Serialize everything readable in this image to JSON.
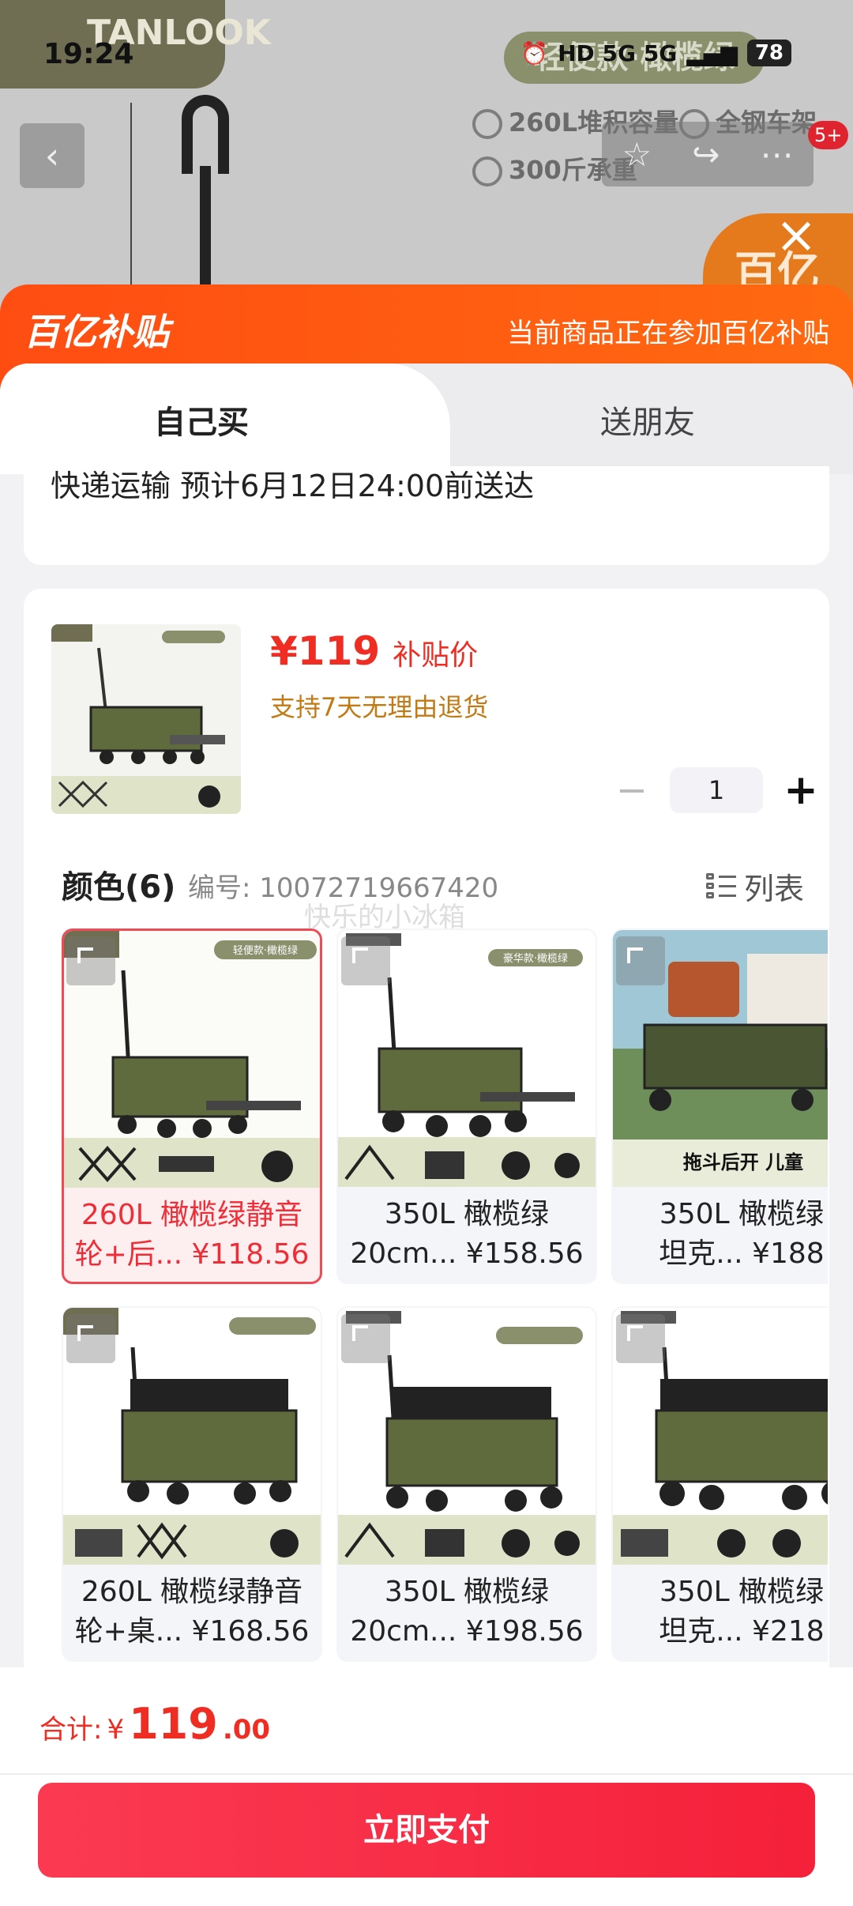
{
  "status_bar": {
    "time": "19:24",
    "network": "HD 5G 5G",
    "battery": "78"
  },
  "background": {
    "brand_logo": "TANLOOK",
    "badge": "轻便款·橄榄绿",
    "features": [
      "260L堆积容量",
      "全钢车架",
      "300斤承重"
    ],
    "corner_logo": "百亿",
    "notification_count": "5+"
  },
  "subsidy_banner": {
    "logo": "百亿补贴",
    "text": "当前商品正在参加百亿补贴"
  },
  "tabs": [
    {
      "label": "自己买"
    },
    {
      "label": "送朋友"
    }
  ],
  "delivery": {
    "text": "快递运输 预计6月12日24:00前送达"
  },
  "product": {
    "price": "¥119",
    "price_label": "补贴价",
    "return_policy": "支持7天无理由退货",
    "quantity": "1"
  },
  "options": {
    "title": "颜色(6)",
    "sku": "编号: 10072719667420",
    "view_mode": "列表",
    "watermark": "快乐的小冰箱",
    "items": [
      {
        "line1": "260L 橄榄绿静音",
        "line2": "轮+后... ¥118.56"
      },
      {
        "line1": "350L 橄榄绿",
        "line2": "20cm... ¥158.56"
      },
      {
        "line1": "350L 橄榄绿",
        "line2": "坦克... ¥188"
      },
      {
        "line1": "260L 橄榄绿静音",
        "line2": "轮+桌... ¥168.56"
      },
      {
        "line1": "350L 橄榄绿",
        "line2": "20cm... ¥198.56"
      },
      {
        "line1": "350L 橄榄绿",
        "line2": "坦克... ¥218"
      }
    ],
    "image_badges": [
      "轻便款·橄榄绿",
      "豪华款·橄榄绿",
      "拖斗后开 儿童"
    ]
  },
  "footer": {
    "total_label": "合计:",
    "total_currency": "¥",
    "total_int": "119",
    "total_dec": ".00",
    "pay_button": "立即支付"
  },
  "colors": {
    "accent": "#f02d23",
    "subsidy_orange": "#ff5a12",
    "wagon_green": "#5f6b3c"
  }
}
